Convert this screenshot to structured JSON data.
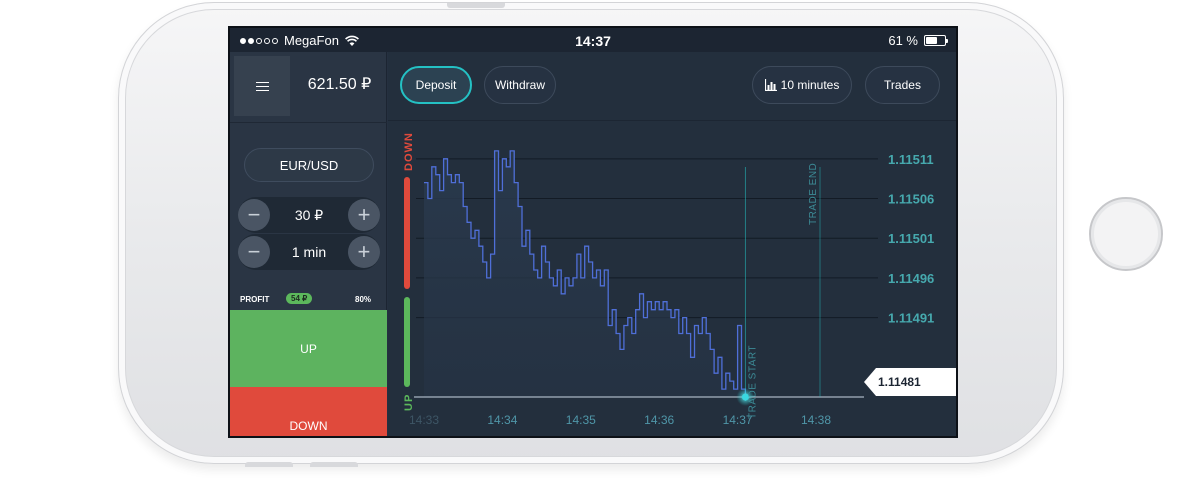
{
  "status_bar": {
    "carrier": "MegaFon",
    "signal_dots": [
      true,
      true,
      false,
      false,
      false
    ],
    "time": "14:37",
    "battery_text": "61 %",
    "battery_level": 0.61
  },
  "sidebar": {
    "balance": "621.50 ₽",
    "pair": "EUR/USD",
    "amount": {
      "minus": "−",
      "value": "30 ₽",
      "plus": "+"
    },
    "duration": {
      "minus": "−",
      "value": "1 min",
      "plus": "+"
    },
    "profit": {
      "label": "PROFIT",
      "amount": "54 ₽",
      "percent": "80%"
    },
    "up_label": "UP",
    "down_label": "DOWN"
  },
  "toolbar": {
    "deposit": "Deposit",
    "withdraw": "Withdraw",
    "timeframe": "10 minutes",
    "trades": "Trades"
  },
  "chart_data": {
    "type": "line",
    "y_ticks": [
      "1.11511",
      "1.11506",
      "1.11501",
      "1.11496",
      "1.11491"
    ],
    "x_ticks": [
      "14:33",
      "14:34",
      "14:35",
      "14:36",
      "14:37",
      "14:38"
    ],
    "ylim": [
      1.11481,
      1.11514
    ],
    "xlim": [
      "14:33",
      "14:38"
    ],
    "current_price": "1.11481",
    "trade_start_label": "TRADE START",
    "trade_end_label": "TRADE END",
    "side_labels": {
      "down": "DOWN",
      "up": "UP"
    },
    "series": [
      {
        "color": "#4f6fd8",
        "points": [
          [
            "14:33:00",
            1.11508
          ],
          [
            "14:33:03",
            1.11506
          ],
          [
            "14:33:06",
            1.1151
          ],
          [
            "14:33:09",
            1.11509
          ],
          [
            "14:33:12",
            1.11507
          ],
          [
            "14:33:15",
            1.11511
          ],
          [
            "14:33:18",
            1.11509
          ],
          [
            "14:33:21",
            1.11508
          ],
          [
            "14:33:24",
            1.11509
          ],
          [
            "14:33:27",
            1.11508
          ],
          [
            "14:33:30",
            1.11505
          ],
          [
            "14:33:33",
            1.11503
          ],
          [
            "14:33:36",
            1.11501
          ],
          [
            "14:33:39",
            1.11502
          ],
          [
            "14:33:42",
            1.115
          ],
          [
            "14:33:45",
            1.11498
          ],
          [
            "14:33:48",
            1.11496
          ],
          [
            "14:33:51",
            1.11499
          ],
          [
            "14:33:54",
            1.11512
          ],
          [
            "14:33:57",
            1.11507
          ],
          [
            "14:34:00",
            1.11511
          ],
          [
            "14:34:03",
            1.1151
          ],
          [
            "14:34:06",
            1.11512
          ],
          [
            "14:34:09",
            1.11508
          ],
          [
            "14:34:12",
            1.11505
          ],
          [
            "14:34:15",
            1.115
          ],
          [
            "14:34:18",
            1.11502
          ],
          [
            "14:34:21",
            1.11499
          ],
          [
            "14:34:24",
            1.11497
          ],
          [
            "14:34:27",
            1.11496
          ],
          [
            "14:34:30",
            1.115
          ],
          [
            "14:34:33",
            1.11498
          ],
          [
            "14:34:36",
            1.11496
          ],
          [
            "14:34:39",
            1.11495
          ],
          [
            "14:34:42",
            1.11497
          ],
          [
            "14:34:45",
            1.11494
          ],
          [
            "14:34:48",
            1.11496
          ],
          [
            "14:34:51",
            1.11495
          ],
          [
            "14:34:54",
            1.11496
          ],
          [
            "14:34:57",
            1.11499
          ],
          [
            "14:35:00",
            1.11496
          ],
          [
            "14:35:03",
            1.115
          ],
          [
            "14:35:06",
            1.11498
          ],
          [
            "14:35:09",
            1.11496
          ],
          [
            "14:35:12",
            1.11497
          ],
          [
            "14:35:15",
            1.11495
          ],
          [
            "14:35:18",
            1.11497
          ],
          [
            "14:35:21",
            1.1149
          ],
          [
            "14:35:24",
            1.11492
          ],
          [
            "14:35:27",
            1.11489
          ],
          [
            "14:35:30",
            1.11487
          ],
          [
            "14:35:33",
            1.1149
          ],
          [
            "14:35:36",
            1.11491
          ],
          [
            "14:35:39",
            1.11489
          ],
          [
            "14:35:42",
            1.11492
          ],
          [
            "14:35:45",
            1.11494
          ],
          [
            "14:35:48",
            1.11491
          ],
          [
            "14:35:51",
            1.11493
          ],
          [
            "14:35:54",
            1.11492
          ],
          [
            "14:35:57",
            1.11493
          ],
          [
            "14:36:00",
            1.11492
          ],
          [
            "14:36:03",
            1.11493
          ],
          [
            "14:36:06",
            1.11492
          ],
          [
            "14:36:09",
            1.11491
          ],
          [
            "14:36:12",
            1.11492
          ],
          [
            "14:36:15",
            1.11489
          ],
          [
            "14:36:18",
            1.11491
          ],
          [
            "14:36:21",
            1.11489
          ],
          [
            "14:36:24",
            1.11486
          ],
          [
            "14:36:27",
            1.1149
          ],
          [
            "14:36:30",
            1.11489
          ],
          [
            "14:36:33",
            1.11491
          ],
          [
            "14:36:36",
            1.11489
          ],
          [
            "14:36:39",
            1.11487
          ],
          [
            "14:36:42",
            1.11484
          ],
          [
            "14:36:45",
            1.11486
          ],
          [
            "14:36:48",
            1.11482
          ],
          [
            "14:36:51",
            1.11484
          ],
          [
            "14:36:54",
            1.11483
          ],
          [
            "14:36:57",
            1.11482
          ],
          [
            "14:37:00",
            1.1149
          ],
          [
            "14:37:03",
            1.11482
          ],
          [
            "14:37:06",
            1.11481
          ]
        ]
      }
    ],
    "colors": {
      "grid": "#131b25",
      "up": "#5cb85c",
      "down": "#e04a3c",
      "accent": "#24c1c4",
      "marker": "#3ad8e0"
    }
  }
}
